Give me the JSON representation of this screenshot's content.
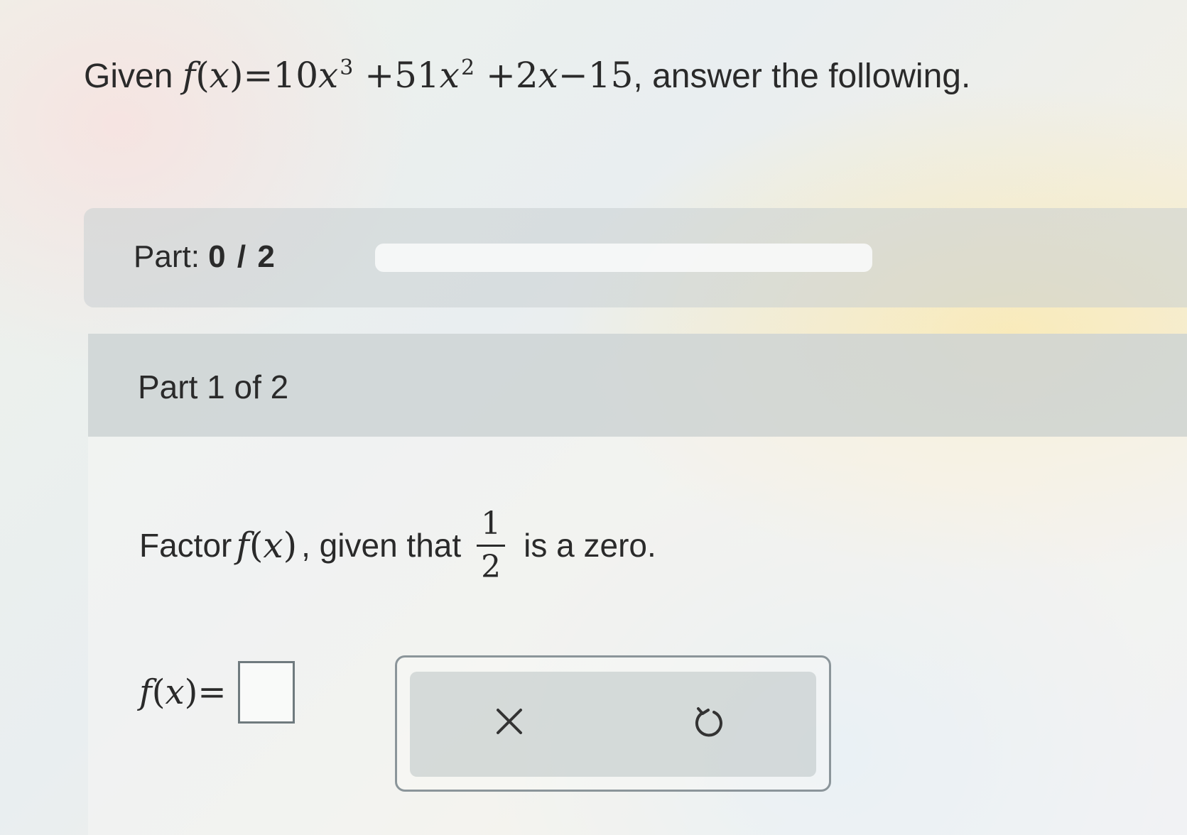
{
  "problem": {
    "given_word": "Given",
    "function_name": "f",
    "variable": "x",
    "equals": "=",
    "terms": {
      "t1_coef": "10",
      "t1_exp": "3",
      "t2": "+51",
      "t2_exp": "2",
      "t3": "+2",
      "t4": "−15"
    },
    "suffix": ", answer the following."
  },
  "progress": {
    "label": "Part:",
    "current": "0",
    "separator": "/",
    "total": "2",
    "fill_fraction": 0
  },
  "part": {
    "title": "Part 1 of 2"
  },
  "question": {
    "prefix": "Factor",
    "middle": ", given that",
    "fraction_numerator": "1",
    "fraction_denominator": "2",
    "suffix": "is a zero."
  },
  "answer": {
    "lhs_function": "f",
    "lhs_variable": "x",
    "equals": "=",
    "value": ""
  },
  "tools": {
    "clear_icon": "close-icon",
    "undo_icon": "undo-icon"
  },
  "colors": {
    "text": "#2a2a2a",
    "input_border": "#6f7a7e"
  }
}
